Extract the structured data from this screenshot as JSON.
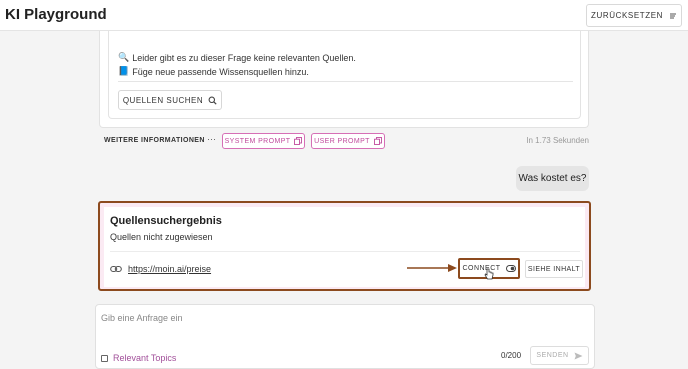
{
  "header": {
    "title": "KI Playground",
    "reset_label": "ZURÜCKSETZEN"
  },
  "answer": {
    "line1": "Leider gibt es zu dieser Frage keine relevanten Quellen.",
    "line2": "Füge neue passende Wissensquellen hinzu.",
    "line1_emoji": "🔍",
    "line2_emoji": "📘",
    "search_label": "QUELLEN SUCHEN"
  },
  "info_row": {
    "more_label": "WEITERE INFORMATIONEN",
    "dots": "···",
    "system_prompt": "SYSTEM PROMPT",
    "user_prompt": "USER PROMPT",
    "time": "In 1.73 Sekunden"
  },
  "user_message": "Was kostet es?",
  "source_result": {
    "title": "Quellensuchergebnis",
    "subtitle": "Quellen nicht zugewiesen",
    "link": "https://moin.ai/preise",
    "connect_label": "CONNECT",
    "view_label": "SIEHE INHALT"
  },
  "composer": {
    "placeholder": "Gib eine Anfrage ein",
    "topics_label": "Relevant Topics",
    "counter": "0/200",
    "send_label": "SENDEN"
  },
  "colors": {
    "accent": "#c04b9d",
    "highlight_border": "#8c4a1e"
  }
}
